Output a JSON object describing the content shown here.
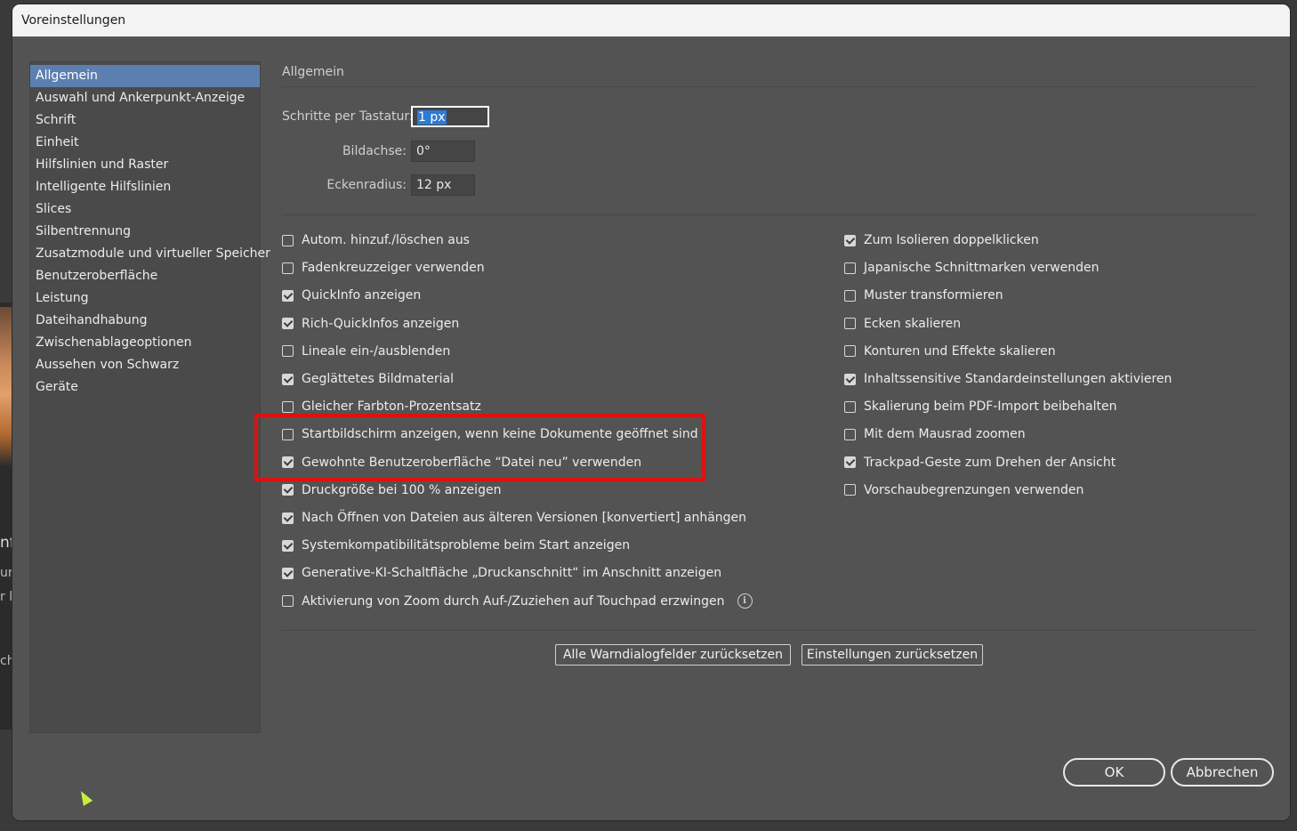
{
  "window": {
    "title": "Voreinstellungen"
  },
  "background_app": {
    "text1": "nf",
    "text2": "ur",
    "text3": "r k",
    "text4": "ch"
  },
  "sidebar": {
    "items": [
      {
        "label": "Allgemein",
        "selected": true
      },
      {
        "label": "Auswahl und Ankerpunkt-Anzeige"
      },
      {
        "label": "Schrift"
      },
      {
        "label": "Einheit"
      },
      {
        "label": "Hilfslinien und Raster"
      },
      {
        "label": "Intelligente Hilfslinien"
      },
      {
        "label": "Slices"
      },
      {
        "label": "Silbentrennung"
      },
      {
        "label": "Zusatzmodule und virtueller Speicher"
      },
      {
        "label": "Benutzeroberfläche"
      },
      {
        "label": "Leistung"
      },
      {
        "label": "Dateihandhabung"
      },
      {
        "label": "Zwischenablageoptionen"
      },
      {
        "label": "Aussehen von Schwarz"
      },
      {
        "label": "Geräte"
      }
    ]
  },
  "main": {
    "section_title": "Allgemein",
    "fields": [
      {
        "label": "Schritte per Tastatur:",
        "value": "1 px",
        "focused": true
      },
      {
        "label": "Bildachse:",
        "value": "0°"
      },
      {
        "label": "Eckenradius:",
        "value": "12 px"
      }
    ],
    "left_options": [
      {
        "label": "Autom. hinzuf./löschen aus",
        "checked": false
      },
      {
        "label": "Fadenkreuzzeiger verwenden",
        "checked": false
      },
      {
        "label": "QuickInfo anzeigen",
        "checked": true
      },
      {
        "label": "Rich-QuickInfos anzeigen",
        "checked": true
      },
      {
        "label": "Lineale ein-/ausblenden",
        "checked": false
      },
      {
        "label": "Geglättetes Bildmaterial",
        "checked": true
      },
      {
        "label": "Gleicher Farbton-Prozentsatz",
        "checked": false
      },
      {
        "label": "Startbildschirm anzeigen, wenn keine Dokumente geöffnet sind",
        "checked": false
      },
      {
        "label": "Gewohnte Benutzeroberfläche “Datei neu” verwenden",
        "checked": true
      },
      {
        "label": "Druckgröße bei 100 % anzeigen",
        "checked": true
      },
      {
        "label": "Nach Öffnen von Dateien aus älteren Versionen [konvertiert] anhängen",
        "checked": true
      },
      {
        "label": "Systemkompatibilitätsprobleme beim Start anzeigen",
        "checked": true
      },
      {
        "label": "Generative-KI-Schaltfläche „Druckanschnitt“ im Anschnitt anzeigen",
        "checked": true
      },
      {
        "label": "Aktivierung von Zoom durch Auf-/Zuziehen auf Touchpad erzwingen",
        "checked": false,
        "info_icon": "info-icon"
      }
    ],
    "right_options": [
      {
        "label": "Zum Isolieren doppelklicken",
        "checked": true
      },
      {
        "label": "Japanische Schnittmarken verwenden",
        "checked": false
      },
      {
        "label": "Muster transformieren",
        "checked": false
      },
      {
        "label": "Ecken skalieren",
        "checked": false
      },
      {
        "label": "Konturen und Effekte skalieren",
        "checked": false
      },
      {
        "label": "Inhaltssensitive Standardeinstellungen aktivieren",
        "checked": true
      },
      {
        "label": "Skalierung beim PDF-Import beibehalten",
        "checked": false
      },
      {
        "label": "Mit dem Mausrad zoomen",
        "checked": false
      },
      {
        "label": "Trackpad-Geste zum Drehen der Ansicht",
        "checked": true
      },
      {
        "label": "Vorschaubegrenzungen verwenden",
        "checked": false
      }
    ],
    "reset_warnings_label": "Alle Warndialogfelder zurücksetzen",
    "reset_prefs_label": "Einstellungen zurücksetzen"
  },
  "footer": {
    "ok_label": "OK",
    "cancel_label": "Abbrechen"
  },
  "annotation": {
    "color": "#e01010"
  },
  "colors": {
    "selection": "#5b7fb0",
    "dialog_bg": "#535353"
  }
}
